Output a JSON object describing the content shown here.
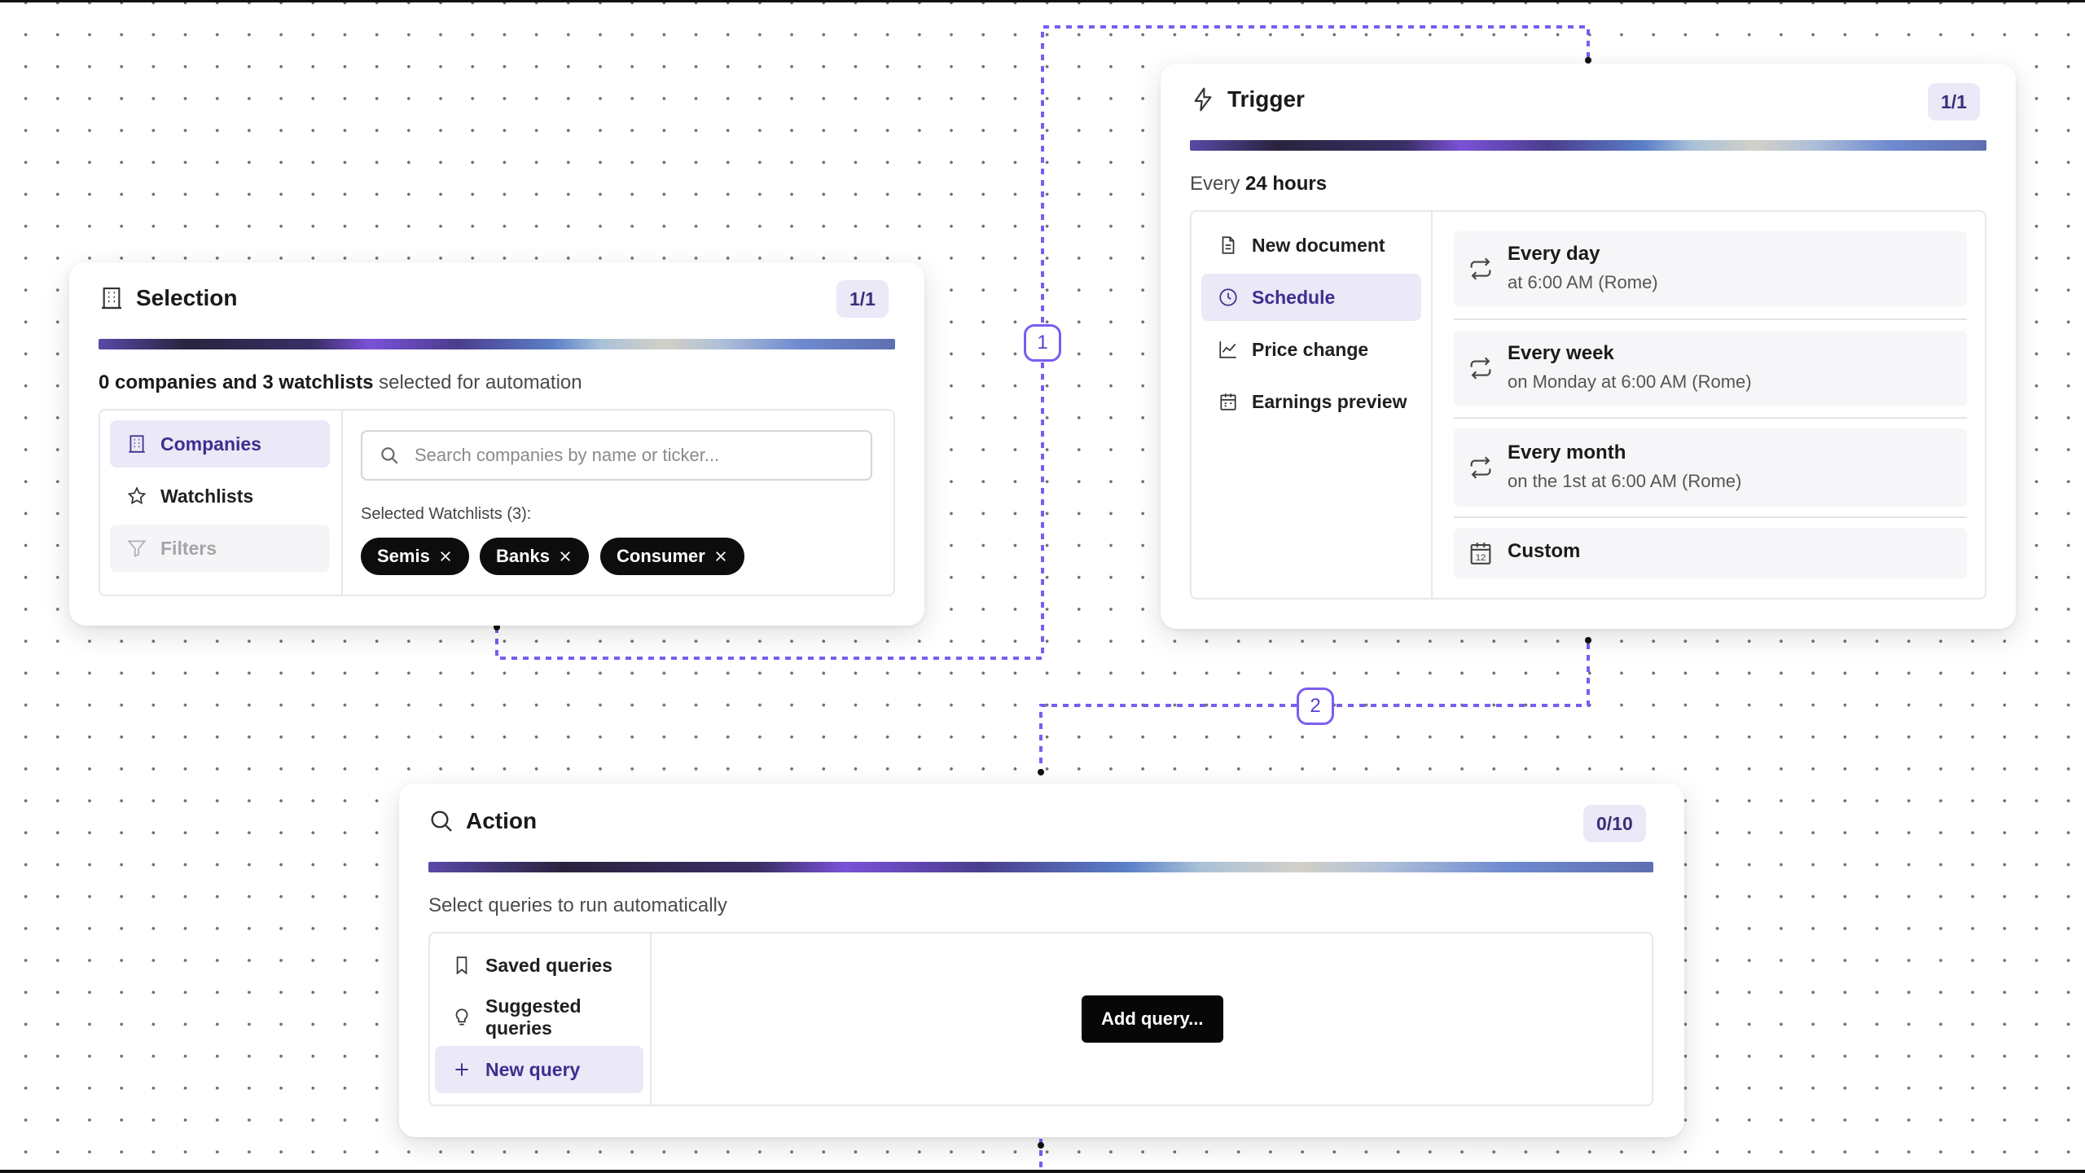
{
  "selection": {
    "title": "Selection",
    "count": "1/1",
    "summary_bold": "0 companies and 3 watchlists",
    "summary_rest": " selected for automation",
    "menu": [
      {
        "label": "Companies",
        "icon": "building-icon",
        "state": "active"
      },
      {
        "label": "Watchlists",
        "icon": "star-icon",
        "state": "normal"
      },
      {
        "label": "Filters",
        "icon": "filter-icon",
        "state": "disabled"
      }
    ],
    "search": {
      "placeholder": "Search companies by name or ticker...",
      "value": ""
    },
    "selected_label": "Selected Watchlists (3):",
    "chips": [
      "Semis",
      "Banks",
      "Consumer"
    ]
  },
  "trigger": {
    "title": "Trigger",
    "count": "1/1",
    "summary_prefix": "Every ",
    "summary_bold": "24 hours",
    "menu": [
      {
        "label": "New document",
        "icon": "document-icon",
        "state": "normal"
      },
      {
        "label": "Schedule",
        "icon": "clock-icon",
        "state": "active"
      },
      {
        "label": "Price change",
        "icon": "line-chart-icon",
        "state": "normal"
      },
      {
        "label": "Earnings preview",
        "icon": "calendar-icon",
        "state": "normal"
      }
    ],
    "options": [
      {
        "title": "Every day",
        "detail": "at 6:00 AM (Rome)",
        "icon": "repeat-icon"
      },
      {
        "title": "Every week",
        "detail": "on Monday at 6:00 AM (Rome)",
        "icon": "repeat-icon"
      },
      {
        "title": "Every month",
        "detail": "on the 1st at 6:00 AM (Rome)",
        "icon": "repeat-icon"
      },
      {
        "title": "Custom",
        "detail": "",
        "icon": "calendar-12-icon"
      }
    ],
    "custom_icon_text": "12"
  },
  "action": {
    "title": "Action",
    "count": "0/10",
    "summary": "Select queries to run automatically",
    "menu": [
      {
        "label": "Saved queries",
        "icon": "bookmark-icon",
        "state": "normal"
      },
      {
        "label": "Suggested queries",
        "icon": "lightbulb-icon",
        "state": "normal"
      },
      {
        "label": "New query",
        "icon": "plus-icon",
        "state": "active"
      }
    ],
    "add_button": "Add query..."
  },
  "connectors": {
    "step1": "1",
    "step2": "2"
  },
  "colors": {
    "accent": "#7b5cf0",
    "active_bg": "#ebe8f7",
    "active_text": "#3c2f8e",
    "chip_bg": "#0d0d0d",
    "button_bg": "#070707"
  }
}
